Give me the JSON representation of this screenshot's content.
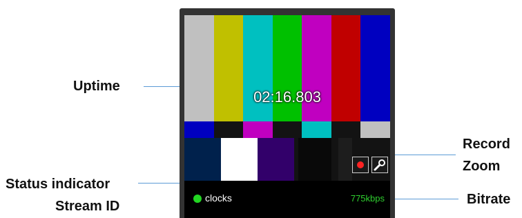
{
  "callouts": {
    "uptime": "Uptime",
    "status_indicator": "Status indicator",
    "stream_id": "Stream ID",
    "record": "Record",
    "zoom": "Zoom",
    "bitrate": "Bitrate"
  },
  "player": {
    "uptime": "02:16.803",
    "stream_id": "clocks",
    "bitrate": "775kbps",
    "buttons": {
      "record_icon": "record-icon",
      "zoom_icon": "magnifier-icon"
    },
    "status_color": "#22d622",
    "bitrate_color": "#2fd02f",
    "record_color": "#ff2222"
  },
  "test_pattern": {
    "top": [
      "#c0c0c0",
      "#c0c000",
      "#00c0c0",
      "#00c000",
      "#c000c0",
      "#c00000",
      "#0000c0"
    ],
    "middle": [
      "#0000c0",
      "#131313",
      "#c000c0",
      "#131313",
      "#00c0c0",
      "#131313",
      "#c0c0c0"
    ],
    "bottom": [
      "#00214c",
      "#ffffff",
      "#32006a",
      "#131313",
      "#090909",
      "#131313",
      "#1d1d1d",
      "#131313"
    ]
  }
}
